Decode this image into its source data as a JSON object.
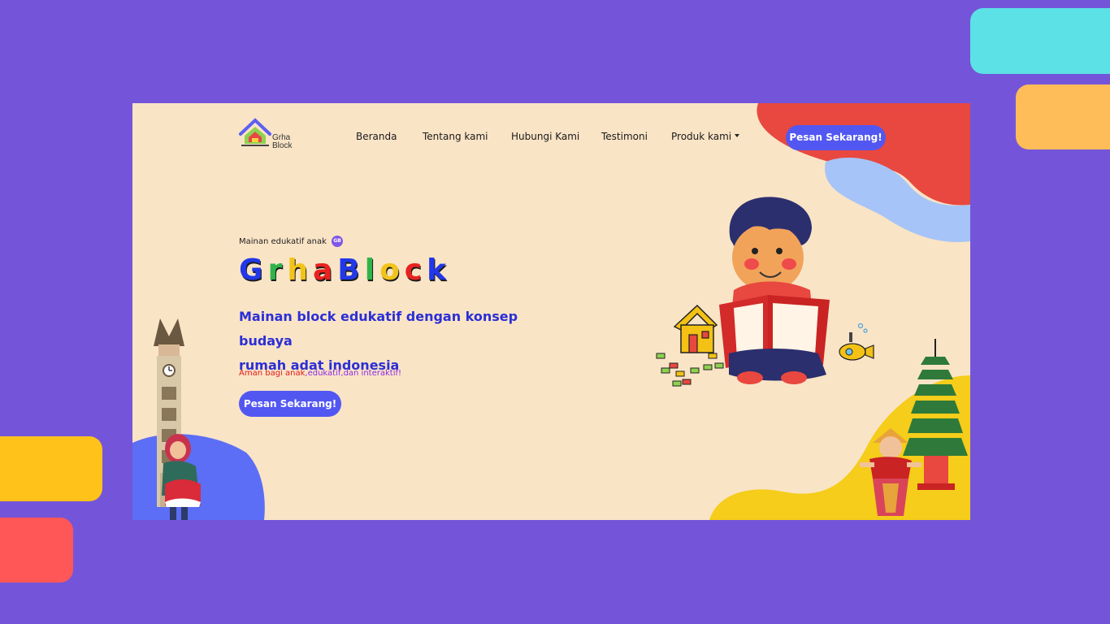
{
  "colors": {
    "page_background": "#7455d9",
    "content_background": "#fae4c6",
    "primary_button": "#5257f2",
    "heading_blue": "#2b2fd6",
    "decor_cyan": "#5ce1e6",
    "decor_orange": "#ffbd59",
    "decor_yellow": "#ffc21a",
    "decor_red": "#ff5757"
  },
  "logo": {
    "name_line1": "Grha",
    "name_line2": "Block"
  },
  "nav": {
    "items": [
      {
        "label": "Beranda"
      },
      {
        "label": "Tentang kami"
      },
      {
        "label": "Hubungi Kami"
      },
      {
        "label": "Testimoni"
      },
      {
        "label": "Produk kami",
        "has_dropdown": true
      }
    ],
    "cta_label": "Pesan Sekarang!"
  },
  "hero": {
    "eyebrow": "Mainan edukatif anak",
    "badge": "GB",
    "brand_letters": [
      {
        "char": "G",
        "color": "#2238e8"
      },
      {
        "char": "r",
        "color": "#2fb34a"
      },
      {
        "char": "h",
        "color": "#f2c41b"
      },
      {
        "char": "a",
        "color": "#e8231f"
      },
      {
        "char": "B",
        "color": "#2238e8"
      },
      {
        "char": "l",
        "color": "#2fb34a"
      },
      {
        "char": "o",
        "color": "#f2c41b"
      },
      {
        "char": "c",
        "color": "#e8231f"
      },
      {
        "char": "k",
        "color": "#2238e8"
      }
    ],
    "tagline_line1": "Mainan block edukatif dengan konsep budaya",
    "tagline_line2": "rumah adat indonesia",
    "safety_part1": "Aman bagi anak",
    "safety_part2": ",edukatif,dan interaktif!",
    "cta_label": "Pesan Sekarang!"
  },
  "illustrations": {
    "left": [
      "clock-tower-icon",
      "hijab-girl-icon"
    ],
    "center": [
      "boy-reading-book-icon",
      "toy-house-icon",
      "lego-blocks-icon",
      "submarine-icon"
    ],
    "right": [
      "pagoda-temple-icon",
      "balinese-dancer-icon"
    ]
  }
}
